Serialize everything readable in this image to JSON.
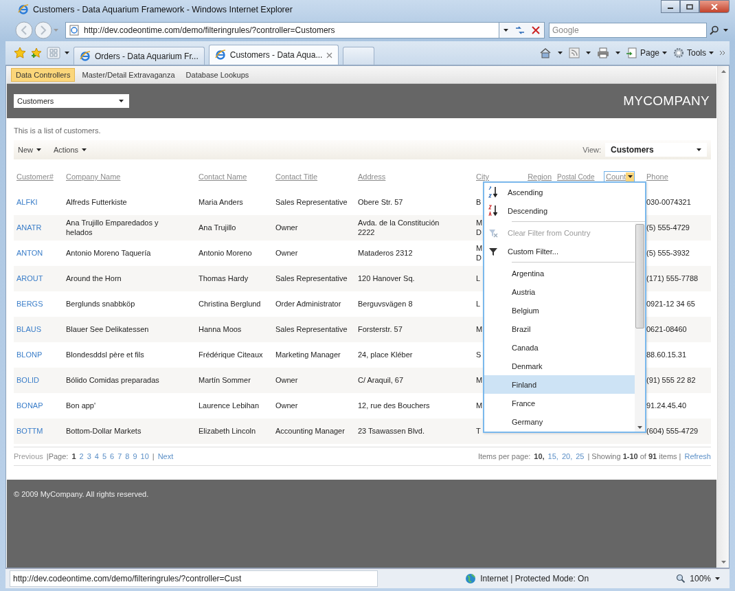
{
  "window": {
    "title": "Customers - Data Aquarium Framework - Windows Internet Explorer"
  },
  "address_bar": {
    "url": "http://dev.codeontime.com/demo/filteringrules/?controller=Customers"
  },
  "search": {
    "placeholder": "Google"
  },
  "tabs": [
    {
      "label": "Orders - Data Aquarium Fr...",
      "selected": false
    },
    {
      "label": "Customers - Data Aqua...",
      "selected": true
    }
  ],
  "command_bar": [
    "Page",
    "Tools"
  ],
  "nav": [
    {
      "label": "Data Controllers",
      "selected": true
    },
    {
      "label": "Master/Detail Extravaganza",
      "selected": false
    },
    {
      "label": "Database Lookups",
      "selected": false
    }
  ],
  "header": {
    "controller": "Customers",
    "brand": "MYCOMPANY"
  },
  "description": "This is a list of customers.",
  "toolbar": {
    "actions": [
      "New",
      "Actions"
    ],
    "view_label": "View:",
    "view": "Customers"
  },
  "table": {
    "columns": [
      "Customer#",
      "Company Name",
      "Contact Name",
      "Contact Title",
      "Address",
      "City",
      "Region",
      "Postal Code",
      "Count",
      "Phone"
    ],
    "rows": [
      {
        "id": "ALFKI",
        "company": "Alfreds Futterkiste",
        "contact": "Maria Anders",
        "title": "Sales Representative",
        "address": "Obere Str. 57",
        "city": "B",
        "phone": "030-0074321"
      },
      {
        "id": "ANATR",
        "company": "Ana Trujillo Emparedados y helados",
        "contact": "Ana Trujillo",
        "title": "Owner",
        "address": "Avda. de la Constitución 2222",
        "city": "M\nD",
        "phone": "(5) 555-4729"
      },
      {
        "id": "ANTON",
        "company": "Antonio Moreno Taquería",
        "contact": "Antonio Moreno",
        "title": "Owner",
        "address": "Mataderos 2312",
        "city": "M\nD",
        "phone": "(5) 555-3932"
      },
      {
        "id": "AROUT",
        "company": "Around the Horn",
        "contact": "Thomas Hardy",
        "title": "Sales Representative",
        "address": "120 Hanover Sq.",
        "city": "L",
        "phone": "(171) 555-7788"
      },
      {
        "id": "BERGS",
        "company": "Berglunds snabbköp",
        "contact": "Christina Berglund",
        "title": "Order Administrator",
        "address": "Berguvsvägen 8",
        "city": "L",
        "phone": "0921-12 34 65"
      },
      {
        "id": "BLAUS",
        "company": "Blauer See Delikatessen",
        "contact": "Hanna Moos",
        "title": "Sales Representative",
        "address": "Forsterstr. 57",
        "city": "M",
        "phone": "0621-08460"
      },
      {
        "id": "BLONP",
        "company": "Blondesddsl père et fils",
        "contact": "Frédérique Citeaux",
        "title": "Marketing Manager",
        "address": "24, place Kléber",
        "city": "S",
        "phone": "88.60.15.31"
      },
      {
        "id": "BOLID",
        "company": "Bólido Comidas preparadas",
        "contact": "Martín Sommer",
        "title": "Owner",
        "address": "C/ Araquil, 67",
        "city": "M",
        "phone": "(91) 555 22 82"
      },
      {
        "id": "BONAP",
        "company": "Bon app'",
        "contact": "Laurence Lebihan",
        "title": "Owner",
        "address": "12, rue des Bouchers",
        "city": "M",
        "phone": "91.24.45.40"
      },
      {
        "id": "BOTTM",
        "company": "Bottom-Dollar Markets",
        "contact": "Elizabeth Lincoln",
        "title": "Accounting Manager",
        "address": "23 Tsawassen Blvd.",
        "city": "T",
        "phone": "(604) 555-4729"
      }
    ]
  },
  "column_menu": {
    "sort": [
      {
        "label": "Ascending",
        "kind": "ascending"
      },
      {
        "label": "Descending",
        "kind": "descending"
      }
    ],
    "filters": [
      {
        "label": "Clear Filter from Country",
        "kind": "clear",
        "disabled": true
      },
      {
        "label": "Custom Filter...",
        "kind": "custom",
        "disabled": false
      }
    ],
    "values": [
      {
        "label": "Argentina",
        "selected": false
      },
      {
        "label": "Austria",
        "selected": false
      },
      {
        "label": "Belgium",
        "selected": false
      },
      {
        "label": "Brazil",
        "selected": false
      },
      {
        "label": "Canada",
        "selected": false
      },
      {
        "label": "Denmark",
        "selected": false
      },
      {
        "label": "Finland",
        "selected": true
      },
      {
        "label": "France",
        "selected": false
      },
      {
        "label": "Germany",
        "selected": false
      }
    ]
  },
  "pager": {
    "previous": "Previous",
    "page_label": "|Page:",
    "pages": [
      {
        "label": "1",
        "selected": true
      },
      {
        "label": "2",
        "selected": false
      },
      {
        "label": "3",
        "selected": false
      },
      {
        "label": "4",
        "selected": false
      },
      {
        "label": "5",
        "selected": false
      },
      {
        "label": "6",
        "selected": false
      },
      {
        "label": "7",
        "selected": false
      },
      {
        "label": "8",
        "selected": false
      },
      {
        "label": "9",
        "selected": false
      },
      {
        "label": "10",
        "selected": false
      }
    ],
    "separator": "|",
    "next": "Next",
    "items_per_page_label": "Items per page:",
    "page_sizes": [
      {
        "label": "10,",
        "selected": true
      },
      {
        "label": "15,",
        "selected": false
      },
      {
        "label": "20,",
        "selected": false
      },
      {
        "label": "25",
        "selected": false
      }
    ],
    "summary": "| Showing **1-10** of **91** items |",
    "refresh": "Refresh"
  },
  "footer": "© 2009 MyCompany. All rights reserved.",
  "status_bar": {
    "url": "http://dev.codeontime.com/demo/filteringrules/?controller=Cust",
    "zone": "Internet | Protected Mode: On",
    "zoom": "100%"
  }
}
